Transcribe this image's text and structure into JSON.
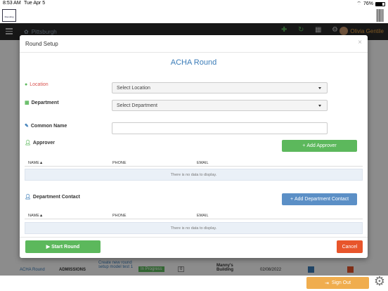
{
  "status_bar": {
    "time": "8:53 AM",
    "date": "Tue Apr 5",
    "battery": "76%"
  },
  "app": {
    "logo_text": "Rounding"
  },
  "navbar": {
    "location": "Pittsburgh",
    "user": "Olivia Gentile"
  },
  "modal": {
    "title": "Round Setup",
    "close_label": "×",
    "round_name": "ACHA Round",
    "location_label": "Location",
    "location_select": "Select Location",
    "department_label": "Department",
    "department_select": "Select Department",
    "common_name_label": "Common Name",
    "common_name_value": "",
    "approver_label": "Approver",
    "add_approver": "Add Approver",
    "approver_table": {
      "columns": [
        "NAME▲",
        "PHONE",
        "EMAIL"
      ],
      "empty": "There is no data to display."
    },
    "dept_contact_label": "Department Contact",
    "add_dept_contact": "Add Department Contact",
    "contact_table": {
      "columns": [
        "NAME▲",
        "PHONE",
        "EMAIL"
      ],
      "empty": "There is no data to display."
    },
    "start_round": "Start Round",
    "cancel": "Cancel"
  },
  "background_row": {
    "round": "ACHA Round",
    "dept": "ADMISSIONS",
    "desc": "Create new round setup model test 1",
    "status": "In Progress",
    "count": "0",
    "building": "Manny's Building",
    "date": "02/08/2022"
  },
  "sign_out": "Sign Out",
  "colors": {
    "accent": "#3b7cb8",
    "green": "#5cb85c",
    "blue": "#5b8fc6",
    "cancel": "#e8552b",
    "signout": "#f0ad4e"
  }
}
